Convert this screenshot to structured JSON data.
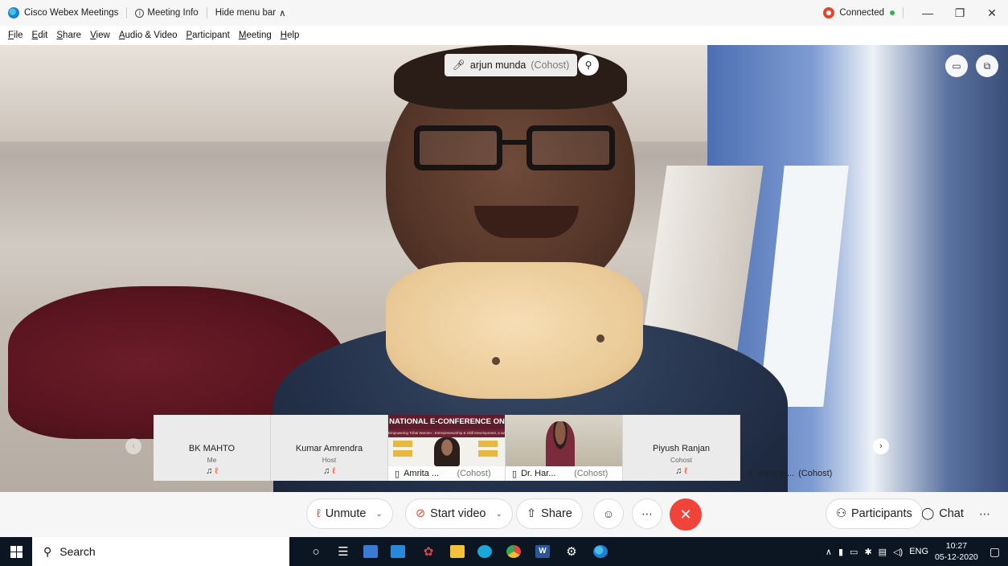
{
  "titlebar": {
    "app_name": "Cisco Webex Meetings",
    "meeting_info": "Meeting Info",
    "hide_menu": "Hide menu bar",
    "status": "Connected"
  },
  "menu": {
    "items": [
      {
        "u": "F",
        "rest": "ile"
      },
      {
        "u": "E",
        "rest": "dit"
      },
      {
        "u": "S",
        "rest": "hare"
      },
      {
        "u": "V",
        "rest": "iew"
      },
      {
        "u": "A",
        "rest": "udio & Video"
      },
      {
        "u": "P",
        "rest": "articipant"
      },
      {
        "u": "M",
        "rest": "eeting"
      },
      {
        "u": "H",
        "rest": "elp"
      }
    ]
  },
  "active_speaker": {
    "name": "arjun munda",
    "role": "(Cohost)"
  },
  "thumbnails": [
    {
      "name": "BK MAHTO",
      "role": "Me"
    },
    {
      "name": "Kumar Amrendra",
      "role": "Host"
    },
    {
      "name": "Amrita ...",
      "role": "(Cohost)",
      "poster_title": "NATIONAL E-CONFERENCE ON",
      "poster_subtitle": "Empowering Tribal Women : Entrepreneurship & Skill Development, a way towards Viksit Bharat"
    },
    {
      "name": "Dr. Har...",
      "role": "(Cohost)"
    },
    {
      "name": "Piyush Ranjan",
      "role": "Cohost"
    },
    {
      "name": "arjun m...",
      "role": "(Cohost)"
    }
  ],
  "controls": {
    "unmute": "Unmute",
    "start_video": "Start video",
    "share": "Share",
    "participants": "Participants",
    "chat": "Chat"
  },
  "taskbar": {
    "search_placeholder": "Search",
    "language": "ENG",
    "time": "10:27",
    "date": "05-12-2020"
  },
  "colors": {
    "end_call": "#f0443a",
    "muted": "#e2462a",
    "connected": "#2fb34a"
  }
}
